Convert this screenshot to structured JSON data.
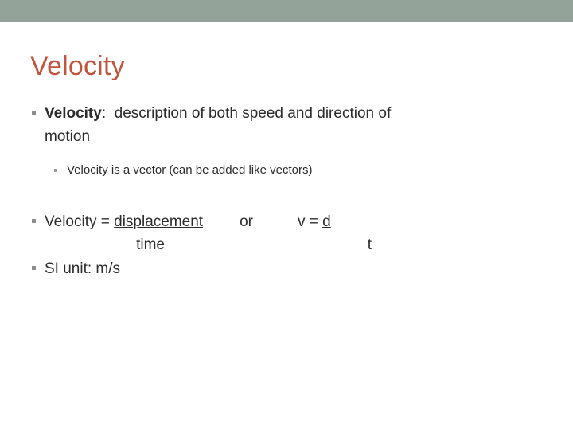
{
  "slide": {
    "title": "Velocity",
    "accent_color": "#c0543c",
    "banner_color": "#93a399",
    "background_color": "#ffffff",
    "text_color": "#2b2b2b",
    "bullet_marker_color": "#8d8d8d"
  },
  "content": {
    "bullet1": {
      "term": "Velocity",
      "colon": ":",
      "lead": "description of both ",
      "emph1": "speed",
      "mid": " and ",
      "emph2": "direction",
      "tail": " of",
      "wrap_line": "motion"
    },
    "subbullet1": {
      "text": "Velocity is a vector (can be added like vectors)"
    },
    "equation": {
      "label": "Velocity = ",
      "numerator": "displacement",
      "denominator": "time",
      "connector": "or",
      "short_label": "v = ",
      "short_numerator": "d",
      "short_denominator": "t"
    },
    "bullet3": {
      "text": "SI unit: m/s"
    }
  }
}
